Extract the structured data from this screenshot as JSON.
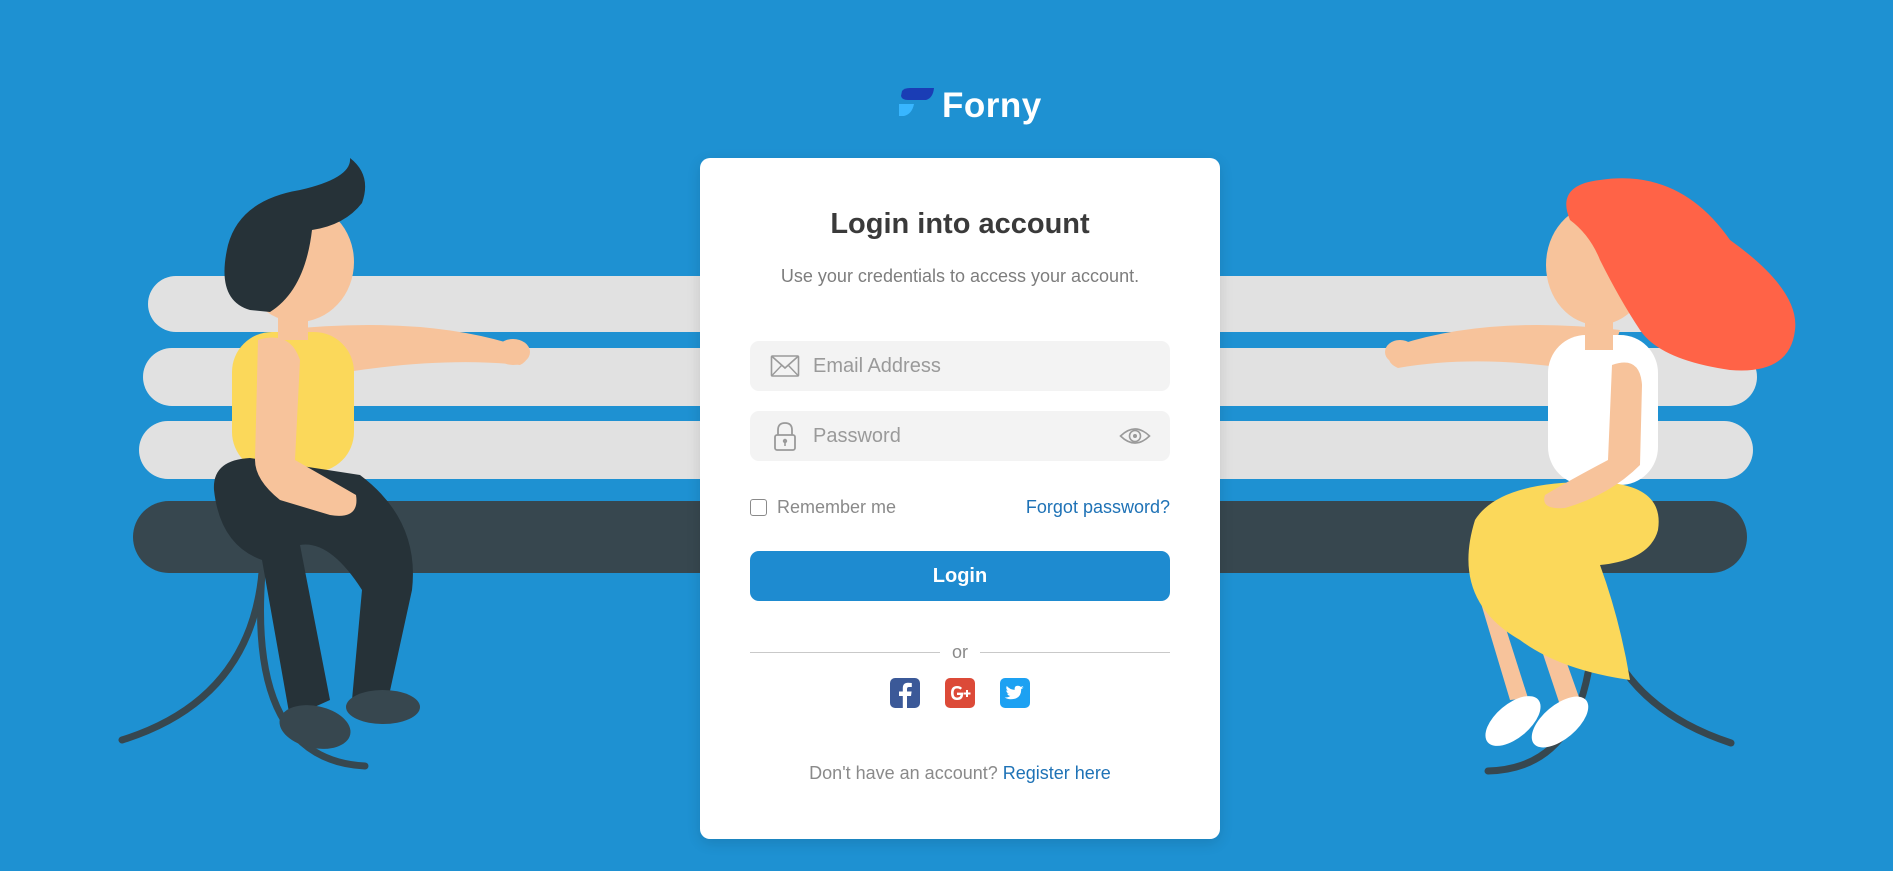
{
  "brand": {
    "name": "Forny"
  },
  "login": {
    "title": "Login into account",
    "subtitle": "Use your credentials to access your account.",
    "email_placeholder": "Email Address",
    "password_placeholder": "Password",
    "remember_label": "Remember me",
    "forgot_label": "Forgot password?",
    "login_button": "Login",
    "divider_text": "or",
    "signup_prompt": "Don't have an account?",
    "signup_link": "Register here"
  },
  "icons": {
    "email": "envelope-icon",
    "password": "lock-icon",
    "show_password": "eye-icon",
    "social": [
      "facebook-icon",
      "google-plus-icon",
      "twitter-icon"
    ]
  },
  "colors": {
    "background": "#1e91d2",
    "primary": "#1e8bd0",
    "link": "#1e72b6",
    "facebook": "#3b5998",
    "google_plus": "#dc4a38",
    "twitter": "#1da1f2"
  }
}
